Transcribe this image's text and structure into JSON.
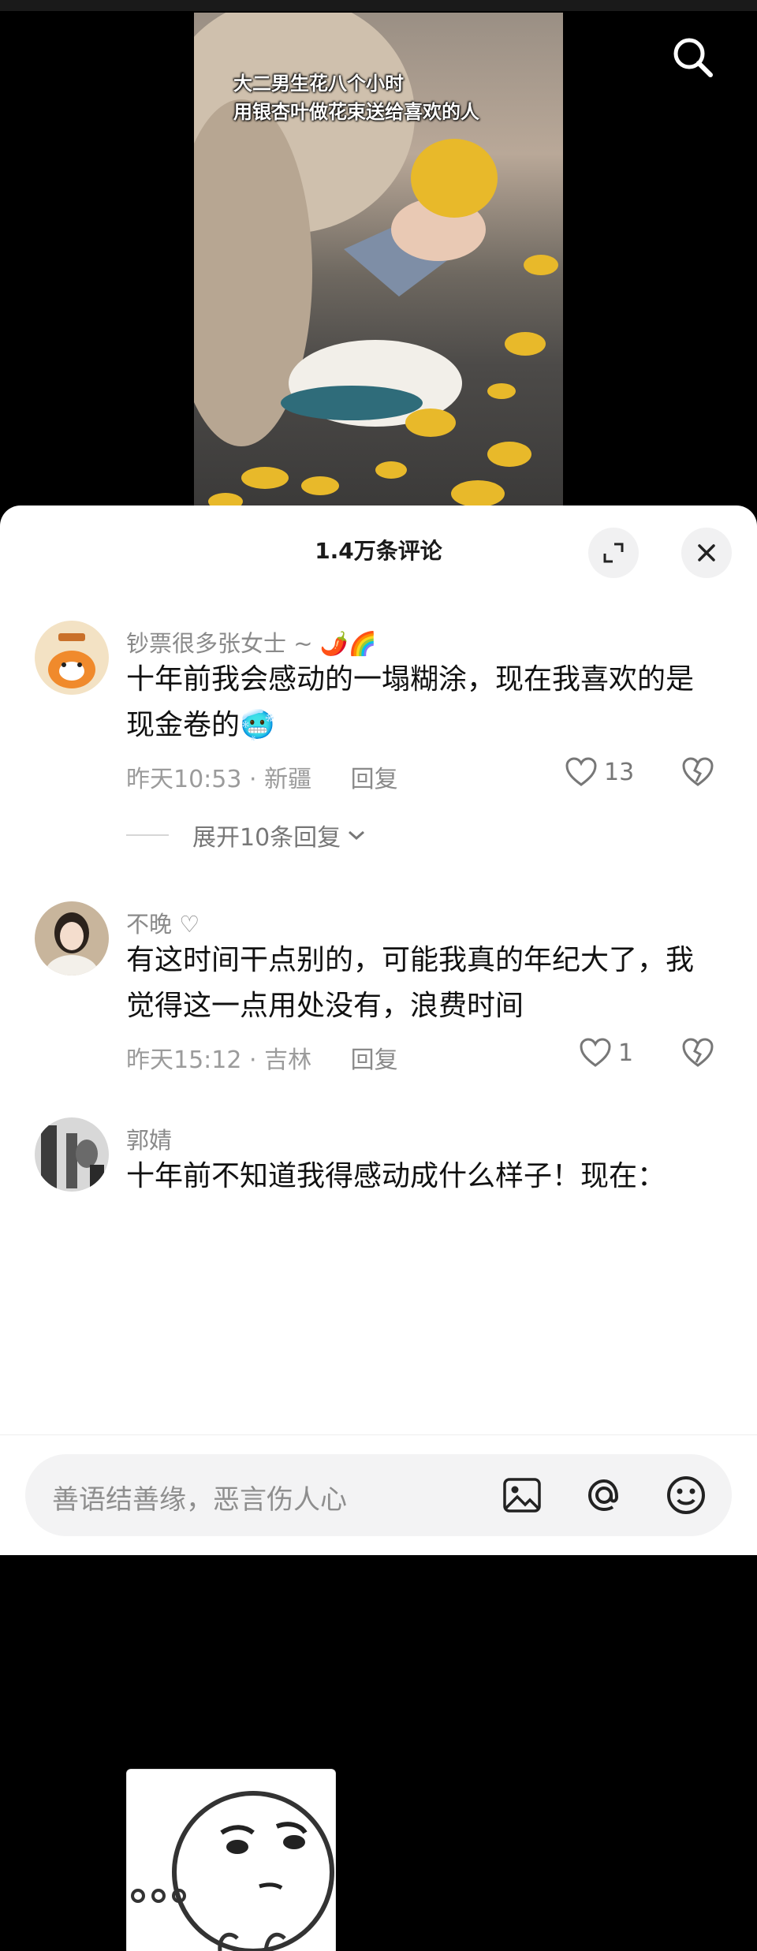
{
  "video": {
    "caption_line1": "大二男生花八个小时",
    "caption_line2": "用银杏叶做花束送给喜欢的人"
  },
  "sheet": {
    "title": "1.4万条评论"
  },
  "comments": [
    {
      "username": "钞票很多张女士 ~ 🌶️🌈",
      "text": "十年前我会感动的一塌糊涂，现在我喜欢的是现金卷的🥶",
      "time": "昨天10:53",
      "location": "新疆",
      "reply_label": "回复",
      "likes": "13",
      "expand_label": "展开10条回复"
    },
    {
      "username": "不晚 ♡",
      "text": "有这时间干点别的，可能我真的年纪大了，我觉得这一点用处没有，浪费时间",
      "time": "昨天15:12",
      "location": "吉林",
      "reply_label": "回复",
      "likes": "1"
    },
    {
      "username": "郭婧",
      "text": "十年前不知道我得感动成什么样子！现在："
    }
  ],
  "input": {
    "placeholder": "善语结善缘，恶言伤人心"
  },
  "colors": {
    "sheet_bg": "#ffffff",
    "text": "#111111",
    "muted": "#9b9b9b",
    "ginkgo": "#e8b92a"
  }
}
